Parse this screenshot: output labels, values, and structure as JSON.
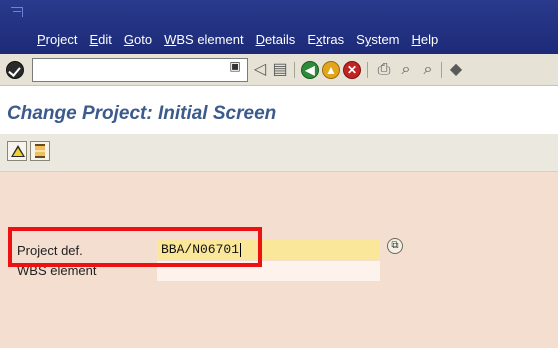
{
  "menu": {
    "items": [
      "Project",
      "Edit",
      "Goto",
      "WBS element",
      "Details",
      "Extras",
      "System",
      "Help"
    ],
    "underline_letters": [
      "P",
      "E",
      "G",
      "W",
      "D",
      "x",
      "y",
      "H"
    ]
  },
  "toolbar": {
    "icons": [
      "enter-icon",
      "save-icon",
      "back-icon",
      "exit-icon",
      "cancel-icon",
      "print-icon",
      "find-icon",
      "find-next-icon"
    ]
  },
  "page": {
    "title": "Change Project: Initial Screen"
  },
  "app_toolbar": {
    "icons": [
      "warning-icon",
      "hourglass-icon"
    ]
  },
  "form": {
    "project_def_label": "Project def.",
    "project_def_value": "BBA/N06701",
    "wbs_label": "WBS element",
    "wbs_value": ""
  },
  "colors": {
    "menubar": "#1c2a78",
    "title": "#3c5a8c",
    "main_bg": "#f3ded0",
    "active_input": "#fbe79a",
    "highlight": "#ee1111"
  }
}
